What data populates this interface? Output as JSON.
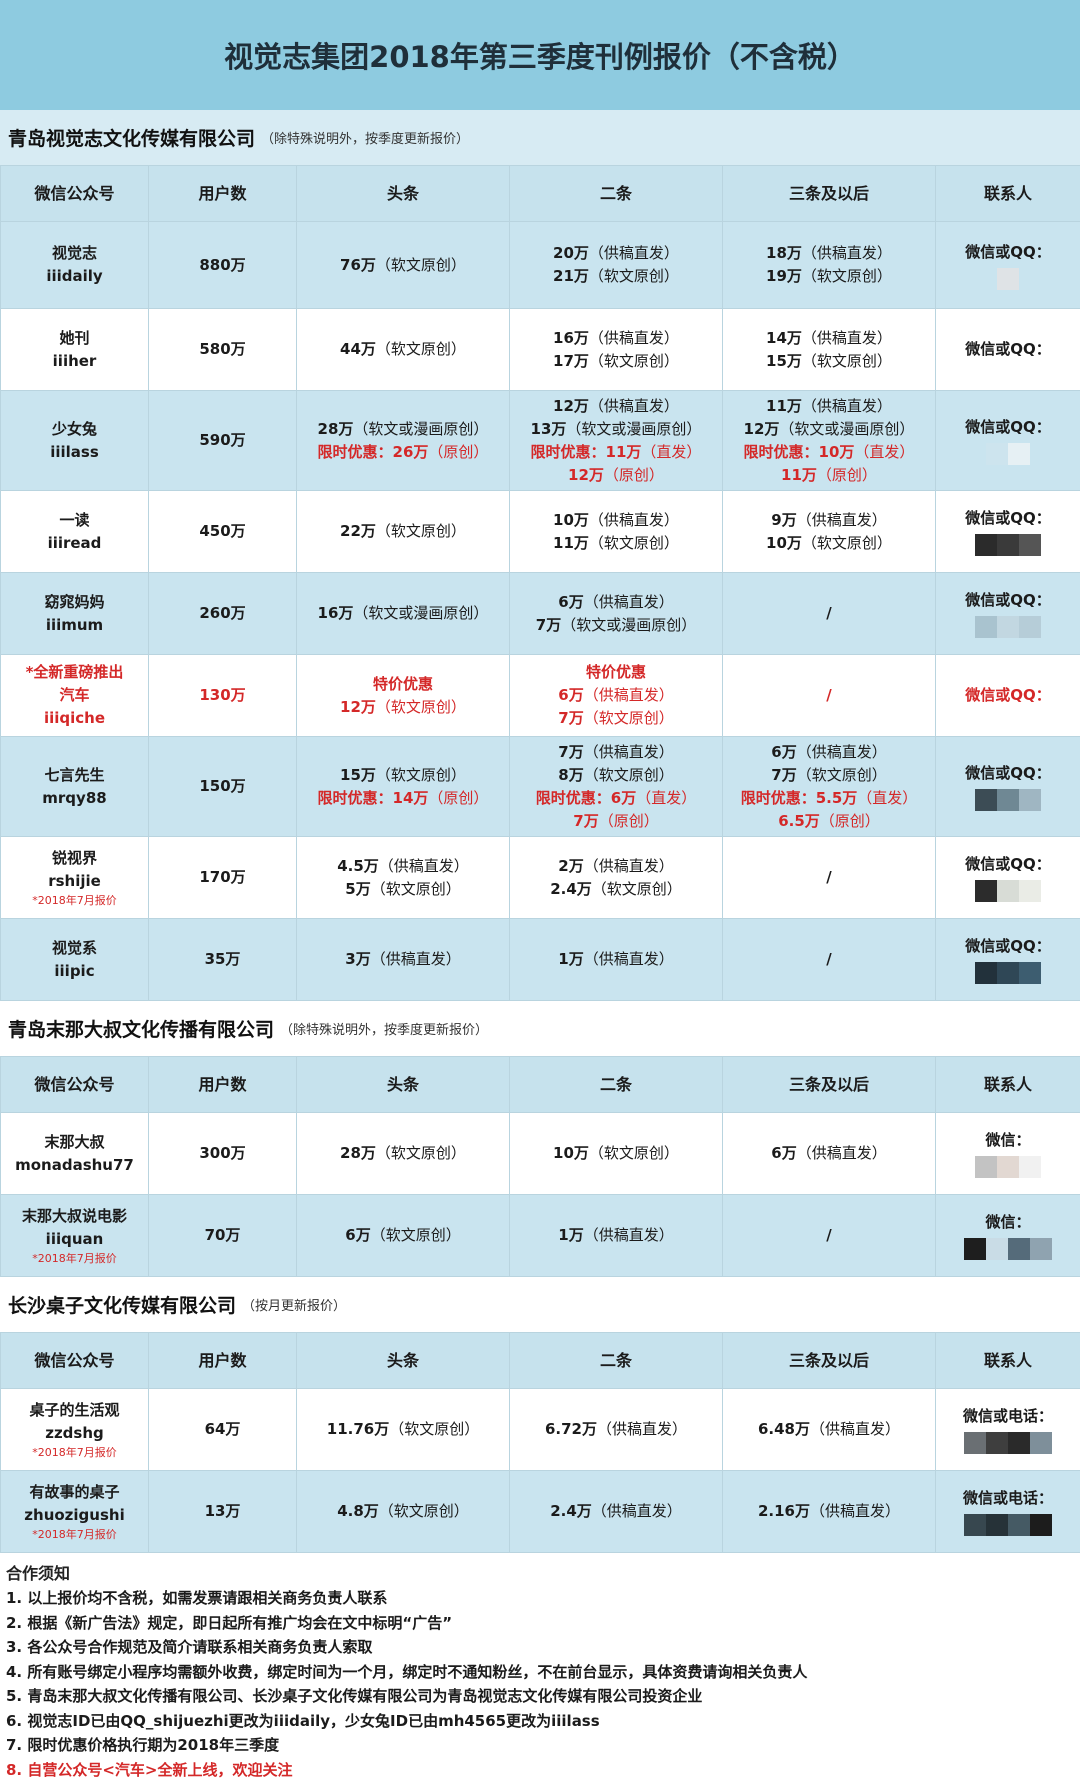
{
  "title": "视觉志集团2018年第三季度刊例报价（不含税）",
  "headers": [
    "微信公众号",
    "用户数",
    "头条",
    "二条",
    "三条及以后",
    "联系人"
  ],
  "sections": [
    {
      "company": "青岛视觉志文化传媒有限公司",
      "note": "（除特殊说明外，按季度更新报价）",
      "rows": [
        {
          "name": [
            {
              "t": "视觉志"
            },
            {
              "t": "iiidaily"
            }
          ],
          "users": "880万",
          "c1": [
            {
              "p": [
                "76万",
                "（软文原创）"
              ]
            }
          ],
          "c2": [
            {
              "p": [
                "20万",
                "（供稿直发）"
              ]
            },
            {
              "p": [
                "21万",
                "（软文原创）"
              ]
            }
          ],
          "c3": [
            {
              "p": [
                "18万",
                "（供稿直发）"
              ]
            },
            {
              "p": [
                "19万",
                "（软文原创）"
              ]
            }
          ],
          "contact": "微信或QQ：",
          "blocks": [
            "#dfe3e6"
          ],
          "h": 87,
          "bg": "b"
        },
        {
          "name": [
            {
              "t": "她刊"
            },
            {
              "t": "iiiher"
            }
          ],
          "users": "580万",
          "c1": [
            {
              "p": [
                "44万",
                "（软文原创）"
              ]
            }
          ],
          "c2": [
            {
              "p": [
                "16万",
                "（供稿直发）"
              ]
            },
            {
              "p": [
                "17万",
                "（软文原创）"
              ]
            }
          ],
          "c3": [
            {
              "p": [
                "14万",
                "（供稿直发）"
              ]
            },
            {
              "p": [
                "15万",
                "（软文原创）"
              ]
            }
          ],
          "contact": "微信或QQ：",
          "blocks": [],
          "h": 82,
          "bg": "w"
        },
        {
          "name": [
            {
              "t": "少女兔"
            },
            {
              "t": "iiilass"
            }
          ],
          "users": "590万",
          "c1": [
            {
              "p": [
                "28万",
                "（软文或漫画原创）"
              ]
            },
            {
              "p": [
                "限时优惠：26万",
                "（原创）"
              ],
              "r": true
            }
          ],
          "c2": [
            {
              "p": [
                "12万",
                "（供稿直发）"
              ]
            },
            {
              "p": [
                "13万",
                "（软文或漫画原创）"
              ]
            },
            {
              "p": [
                "限时优惠：11万",
                "（直发）"
              ],
              "r": true
            },
            {
              "p": [
                "12万",
                "（原创）"
              ],
              "r": true
            }
          ],
          "c3": [
            {
              "p": [
                "11万",
                "（供稿直发）"
              ]
            },
            {
              "p": [
                "12万",
                "（软文或漫画原创）"
              ]
            },
            {
              "p": [
                "限时优惠：10万",
                "（直发）"
              ],
              "r": true
            },
            {
              "p": [
                "11万",
                "（原创）"
              ],
              "r": true
            }
          ],
          "contact": "微信或QQ：",
          "blocks": [
            "#cde4ee",
            "#e6f0f4"
          ],
          "h": 100,
          "bg": "b"
        },
        {
          "name": [
            {
              "t": "一读"
            },
            {
              "t": "iiiread"
            }
          ],
          "users": "450万",
          "c1": [
            {
              "p": [
                "22万",
                "（软文原创）"
              ]
            }
          ],
          "c2": [
            {
              "p": [
                "10万",
                "（供稿直发）"
              ]
            },
            {
              "p": [
                "11万",
                "（软文原创）"
              ]
            }
          ],
          "c3": [
            {
              "p": [
                "9万",
                "（供稿直发）"
              ]
            },
            {
              "p": [
                "10万",
                "（软文原创）"
              ]
            }
          ],
          "contact": "微信或QQ：",
          "blocks": [
            "#2b2b2b",
            "#3a3a3a",
            "#555555"
          ],
          "h": 82,
          "bg": "w"
        },
        {
          "name": [
            {
              "t": "窈窕妈妈"
            },
            {
              "t": "iiimum"
            }
          ],
          "users": "260万",
          "c1": [
            {
              "p": [
                "16万",
                "（软文或漫画原创）"
              ]
            }
          ],
          "c2": [
            {
              "p": [
                "6万",
                "（供稿直发）"
              ]
            },
            {
              "p": [
                "7万",
                "（软文或漫画原创）"
              ]
            }
          ],
          "c3": [
            {
              "p": [
                "/",
                ""
              ]
            }
          ],
          "contact": "微信或QQ：",
          "blocks": [
            "#a9c3cf",
            "#c2d7e1",
            "#b6cdd8"
          ],
          "h": 82,
          "bg": "b"
        },
        {
          "name": [
            {
              "t": "*全新重磅推出",
              "r": true
            },
            {
              "t": "汽车",
              "r": true
            },
            {
              "t": "iiiqiche",
              "r": true
            }
          ],
          "users": "130万",
          "ur": true,
          "c1": [
            {
              "p": [
                "特价优惠",
                ""
              ],
              "r": true
            },
            {
              "p": [
                "12万",
                "（软文原创）"
              ],
              "r": true
            }
          ],
          "c2": [
            {
              "p": [
                "特价优惠",
                ""
              ],
              "r": true
            },
            {
              "p": [
                "6万",
                "（供稿直发）"
              ],
              "r": true
            },
            {
              "p": [
                "7万",
                "（软文原创）"
              ],
              "r": true
            }
          ],
          "c3": [
            {
              "p": [
                "/",
                ""
              ],
              "r": true
            }
          ],
          "contact": "微信或QQ：",
          "cr": true,
          "blocks": [],
          "h": 82,
          "bg": "w"
        },
        {
          "name": [
            {
              "t": "七言先生"
            },
            {
              "t": "mrqy88"
            }
          ],
          "users": "150万",
          "c1": [
            {
              "p": [
                "15万",
                "（软文原创）"
              ]
            },
            {
              "p": [
                "限时优惠：14万",
                "（原创）"
              ],
              "r": true
            }
          ],
          "c2": [
            {
              "p": [
                "7万",
                "（供稿直发）"
              ]
            },
            {
              "p": [
                "8万",
                "（软文原创）"
              ]
            },
            {
              "p": [
                "限时优惠：6万",
                "（直发）"
              ],
              "r": true
            },
            {
              "p": [
                "7万",
                "（原创）"
              ],
              "r": true
            }
          ],
          "c3": [
            {
              "p": [
                "6万",
                "（供稿直发）"
              ]
            },
            {
              "p": [
                "7万",
                "（软文原创）"
              ]
            },
            {
              "p": [
                "限时优惠：5.5万",
                "（直发）"
              ],
              "r": true
            },
            {
              "p": [
                "6.5万",
                "（原创）"
              ],
              "r": true
            }
          ],
          "contact": "微信或QQ：",
          "blocks": [
            "#3c4c55",
            "#6f8894",
            "#9fb6c2"
          ],
          "h": 100,
          "bg": "b"
        },
        {
          "name": [
            {
              "t": "锐视界"
            },
            {
              "t": "rshijie"
            },
            {
              "t": "*2018年7月报价",
              "tiny": true
            }
          ],
          "users": "170万",
          "c1": [
            {
              "p": [
                "4.5万",
                "（供稿直发）"
              ]
            },
            {
              "p": [
                "5万",
                "（软文原创）"
              ]
            }
          ],
          "c2": [
            {
              "p": [
                "2万",
                "（供稿直发）"
              ]
            },
            {
              "p": [
                "2.4万",
                "（软文原创）"
              ]
            }
          ],
          "c3": [
            {
              "p": [
                "/",
                ""
              ]
            }
          ],
          "contact": "微信或QQ：",
          "blocks": [
            "#2c2c2c",
            "#d8dcd6",
            "#eaece6"
          ],
          "h": 82,
          "bg": "w"
        },
        {
          "name": [
            {
              "t": "视觉系"
            },
            {
              "t": "iiipic"
            }
          ],
          "users": "35万",
          "c1": [
            {
              "p": [
                "3万",
                "（供稿直发）"
              ]
            }
          ],
          "c2": [
            {
              "p": [
                "1万",
                "（供稿直发）"
              ]
            }
          ],
          "c3": [
            {
              "p": [
                "/",
                ""
              ]
            }
          ],
          "contact": "微信或QQ：",
          "blocks": [
            "#22313b",
            "#2f4756",
            "#3d5d70"
          ],
          "h": 82,
          "bg": "b"
        }
      ]
    },
    {
      "company": "青岛末那大叔文化传播有限公司",
      "note": "（除特殊说明外，按季度更新报价）",
      "rows": [
        {
          "name": [
            {
              "t": "末那大叔"
            },
            {
              "t": "monadashu77"
            }
          ],
          "users": "300万",
          "c1": [
            {
              "p": [
                "28万",
                "（软文原创）"
              ]
            }
          ],
          "c2": [
            {
              "p": [
                "10万",
                "（软文原创）"
              ]
            }
          ],
          "c3": [
            {
              "p": [
                "6万",
                "（供稿直发）"
              ]
            }
          ],
          "contact": "微信：",
          "blocks": [
            "#c3c3c3",
            "#e2d8d2",
            "#f1f1f1"
          ],
          "h": 82,
          "bg": "w"
        },
        {
          "name": [
            {
              "t": "末那大叔说电影"
            },
            {
              "t": "iiiquan"
            },
            {
              "t": "*2018年7月报价",
              "tiny": true
            }
          ],
          "users": "70万",
          "c1": [
            {
              "p": [
                "6万",
                "（软文原创）"
              ]
            }
          ],
          "c2": [
            {
              "p": [
                "1万",
                "（供稿直发）"
              ]
            }
          ],
          "c3": [
            {
              "p": [
                "/",
                ""
              ]
            }
          ],
          "contact": "微信：",
          "blocks": [
            "#1e1e1e",
            "#c9dce6",
            "#556b7a",
            "#8fa3b0"
          ],
          "h": 82,
          "bg": "b"
        }
      ]
    },
    {
      "company": "长沙桌子文化传媒有限公司",
      "note": "（按月更新报价）",
      "rows": [
        {
          "name": [
            {
              "t": "桌子的生活观"
            },
            {
              "t": "zzdshg"
            },
            {
              "t": "*2018年7月报价",
              "tiny": true
            }
          ],
          "users": "64万",
          "c1": [
            {
              "p": [
                "11.76万",
                "（软文原创）"
              ]
            }
          ],
          "c2": [
            {
              "p": [
                "6.72万",
                "（供稿直发）"
              ]
            }
          ],
          "c3": [
            {
              "p": [
                "6.48万",
                "（供稿直发）"
              ]
            }
          ],
          "contact": "微信或电话：",
          "blocks": [
            "#6a6f73",
            "#3e3e3e",
            "#2a2a2a",
            "#7e8f9a"
          ],
          "h": 82,
          "bg": "w"
        },
        {
          "name": [
            {
              "t": "有故事的桌子"
            },
            {
              "t": "zhuozigushi"
            },
            {
              "t": "*2018年7月报价",
              "tiny": true
            }
          ],
          "users": "13万",
          "c1": [
            {
              "p": [
                "4.8万",
                "（软文原创）"
              ]
            }
          ],
          "c2": [
            {
              "p": [
                "2.4万",
                "（供稿直发）"
              ]
            }
          ],
          "c3": [
            {
              "p": [
                "2.16万",
                "（供稿直发）"
              ]
            }
          ],
          "contact": "微信或电话：",
          "blocks": [
            "#37474f",
            "#263238",
            "#455a64",
            "#1c1c1c"
          ],
          "h": 82,
          "bg": "b"
        }
      ]
    }
  ],
  "notes_title": "合作须知",
  "notes": [
    "1. 以上报价均不含税，如需发票请跟相关商务负责人联系",
    "2. 根据《新广告法》规定，即日起所有推广均会在文中标明“广告”",
    "3. 各公众号合作规范及简介请联系相关商务负责人索取",
    "4. 所有账号绑定小程序均需额外收费，绑定时间为一个月，绑定时不通知粉丝，不在前台显示，具体资费请询相关负责人",
    "5. 青岛末那大叔文化传播有限公司、长沙桌子文化传媒有限公司为青岛视觉志文化传媒有限公司投资企业",
    "6. 视觉志ID已由QQ_shijuezhi更改为iiidaily，少女兔ID已由mh4565更改为iiilass",
    "7. 限时优惠价格执行期为2018年三季度",
    "8. 自营公众号<汽车>全新上线，欢迎关注"
  ],
  "highlight_note_index": 7,
  "colors": {
    "header_bg": "#8ecbe0",
    "row_blue": "#c9e4ef",
    "accent_red": "#d42828"
  }
}
